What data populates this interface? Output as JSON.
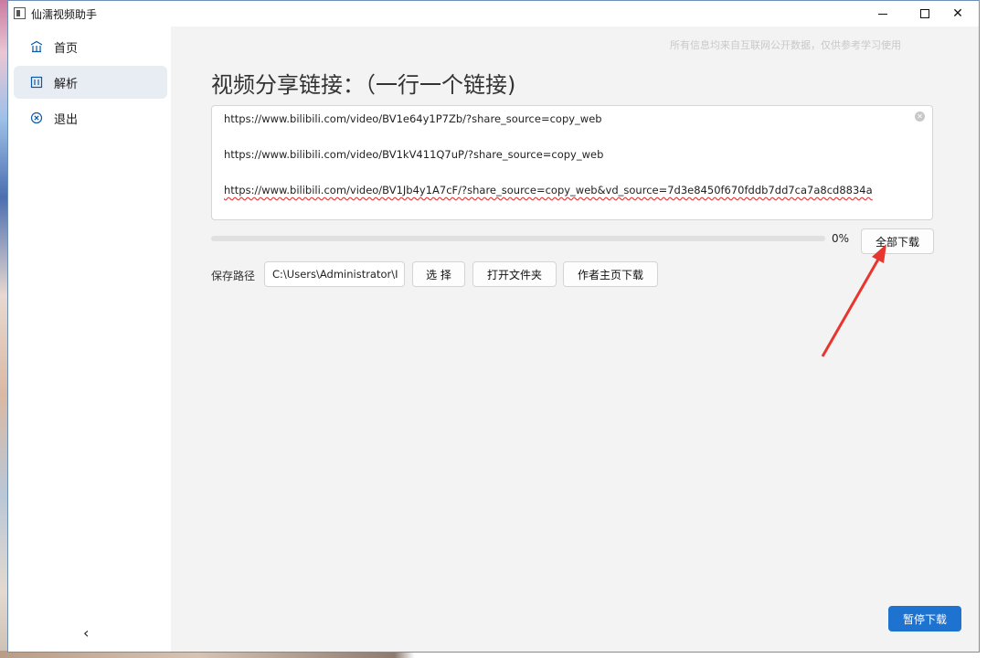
{
  "window": {
    "title": "仙濡视频助手"
  },
  "sidebar": {
    "items": [
      {
        "label": "首页",
        "icon": "home-icon",
        "active": false
      },
      {
        "label": "解析",
        "icon": "parse-icon",
        "active": true
      },
      {
        "label": "退出",
        "icon": "exit-icon",
        "active": false
      }
    ],
    "collapse_glyph": "‹"
  },
  "main": {
    "disclaimer": "所有信息均来自互联网公开数据，仅供参考学习使用",
    "heading": "视频分享链接：（一行一个链接)",
    "links": [
      "https://www.bilibili.com/video/BV1e64y1P7Zb/?share_source=copy_web",
      "https://www.bilibili.com/video/BV1kV411Q7uP/?share_source=copy_web",
      "https://www.bilibili.com/video/BV1Jb4y1A7cF/?share_source=copy_web&vd_source=7d3e8450f670fddb7dd7ca7a8cd8834a"
    ],
    "progress": {
      "value": 0,
      "label": "0%"
    },
    "download_all_label": "全部下载",
    "save_path_label": "保存路径",
    "save_path_value": "C:\\Users\\Administrator\\I",
    "choose_label": "选 择",
    "open_folder_label": "打开文件夹",
    "author_download_label": "作者主页下载",
    "pause_label": "暂停下载"
  },
  "colors": {
    "accent": "#1e73d0",
    "annotation_arrow": "#e8352d"
  }
}
